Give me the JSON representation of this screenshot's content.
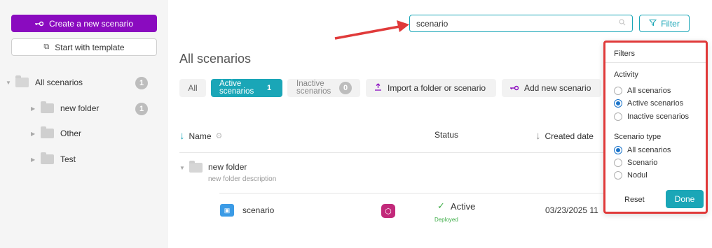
{
  "sidebar": {
    "create_label": "Create a new scenario",
    "template_label": "Start with template",
    "tree": [
      {
        "label": "All scenarios",
        "count": "1"
      },
      {
        "label": "new folder",
        "count": "1"
      },
      {
        "label": "Other"
      },
      {
        "label": "Test"
      }
    ]
  },
  "search": {
    "value": "scenario"
  },
  "filter_button": {
    "label": "Filter"
  },
  "main": {
    "title": "All scenarios",
    "chips": {
      "all": "All",
      "active": "Active\nscenarios",
      "active_count": "1",
      "inactive": "Inactive\nscenarios",
      "inactive_count": "0",
      "import": "Import a folder or scenario",
      "add": "Add new scenario"
    },
    "columns": {
      "name": "Name",
      "status": "Status",
      "created": "Created date"
    },
    "folder": {
      "name": "new folder",
      "description": "new folder description"
    },
    "row": {
      "name": "scenario",
      "status": "Active",
      "status_sub": "Deployed",
      "date": "03/23/2025 11"
    }
  },
  "filters": {
    "title": "Filters",
    "activity_label": "Activity",
    "activity_options": [
      "All scenarios",
      "Active scenarios",
      "Inactive scenarios"
    ],
    "activity_selected": 1,
    "type_label": "Scenario type",
    "type_options": [
      "All scenarios",
      "Scenario",
      "Nodul"
    ],
    "type_selected": 0,
    "reset": "Reset",
    "done": "Done"
  },
  "colors": {
    "accent": "#1aa6b7",
    "create_button": "#8a0bbf",
    "annotation": "#e03a3a"
  }
}
